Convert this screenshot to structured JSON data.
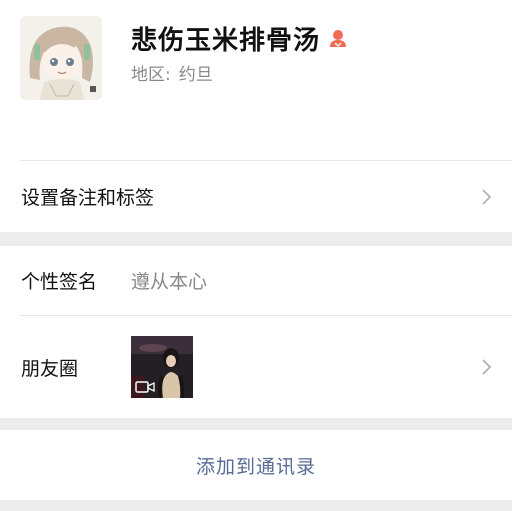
{
  "profile": {
    "name": "悲伤玉米排骨汤",
    "region_label": "地区:",
    "region_value": "约旦",
    "gender_icon": "female-icon"
  },
  "settings": {
    "remark_label": "设置备注和标签"
  },
  "info": {
    "signature_label": "个性签名",
    "signature_value": "遵从本心",
    "moments_label": "朋友圈",
    "moments_thumb_icon": "video-icon"
  },
  "actions": {
    "add_contact_label": "添加到通讯录"
  },
  "colors": {
    "accent_link": "#586b94",
    "gender_female": "#f06b54",
    "secondary_text": "#888888",
    "section_gap": "#ededed"
  }
}
